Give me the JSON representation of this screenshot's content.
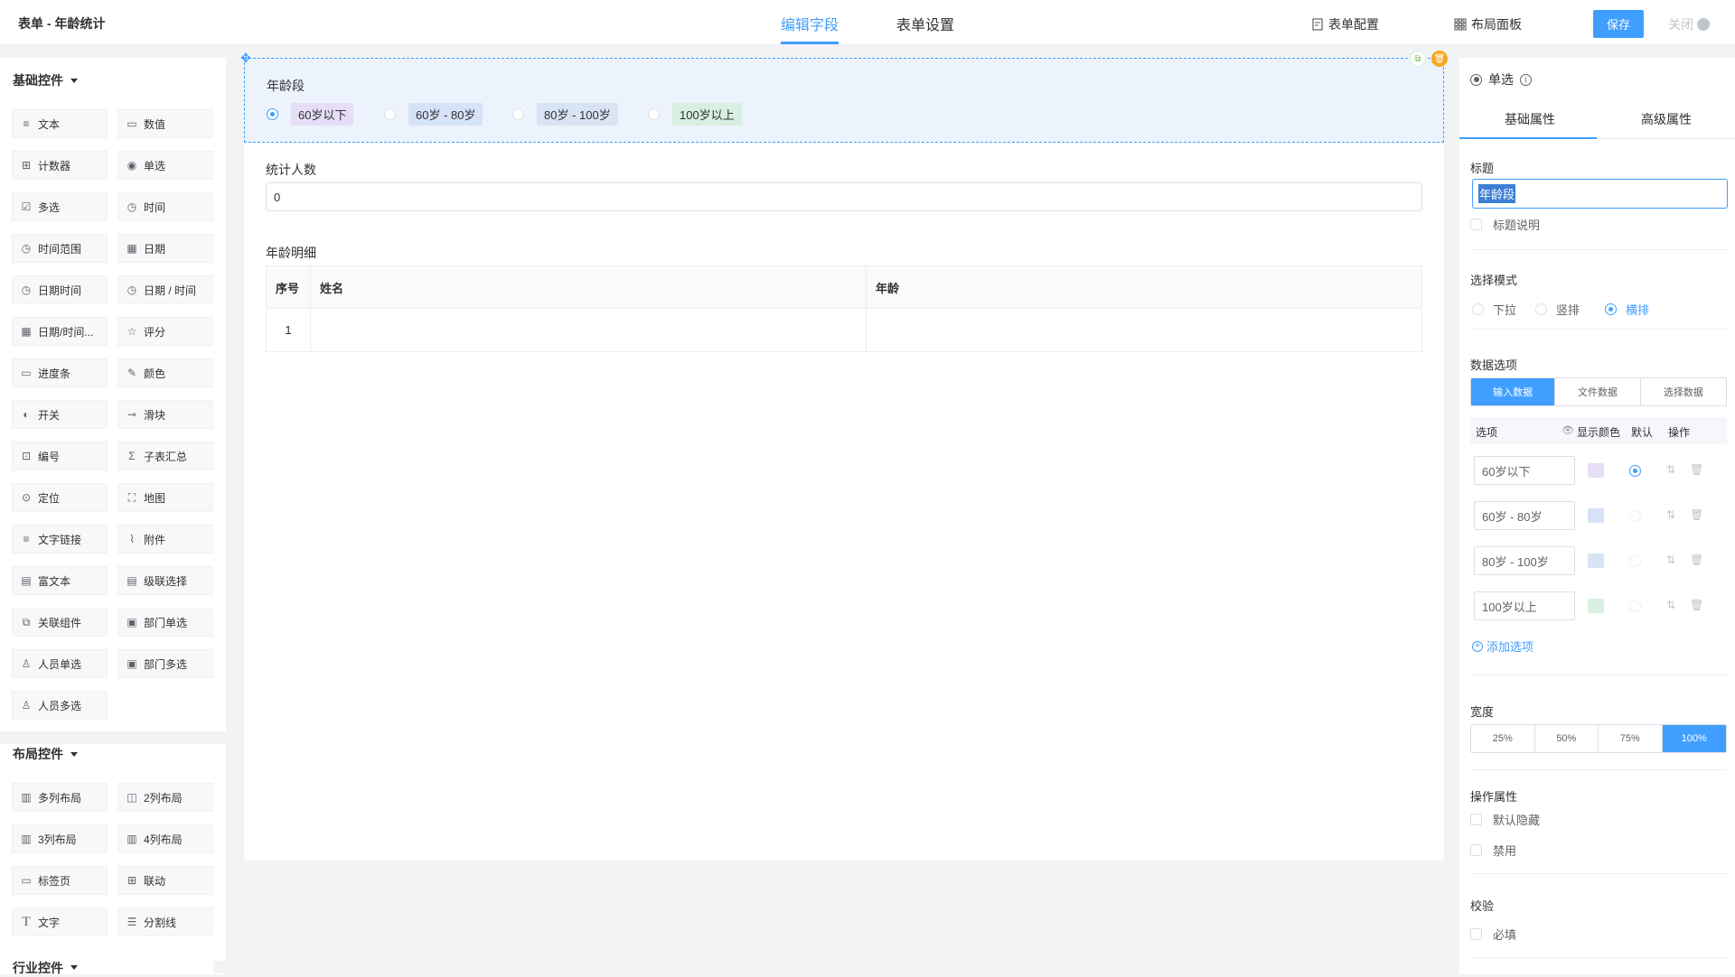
{
  "header": {
    "title": "表单 - 年龄统计",
    "tabs": [
      {
        "label": "编辑字段",
        "active": true
      },
      {
        "label": "表单设置",
        "active": false
      }
    ],
    "form_config": "表单配置",
    "layout_panel": "布局面板",
    "save": "保存",
    "close": "关闭"
  },
  "left": {
    "basic_group": "基础控件",
    "basic": [
      {
        "label": "文本",
        "icon": "text-icon"
      },
      {
        "label": "数值",
        "icon": "number-icon"
      },
      {
        "label": "计数器",
        "icon": "counter-icon"
      },
      {
        "label": "单选",
        "icon": "radio-icon"
      },
      {
        "label": "多选",
        "icon": "checkbox-icon"
      },
      {
        "label": "时间",
        "icon": "clock-icon"
      },
      {
        "label": "时间范围",
        "icon": "clock-icon"
      },
      {
        "label": "日期",
        "icon": "calendar-icon"
      },
      {
        "label": "日期时间",
        "icon": "clock-icon"
      },
      {
        "label": "日期 / 时间",
        "icon": "clock-icon"
      },
      {
        "label": "日期/时间...",
        "icon": "calendar-icon"
      },
      {
        "label": "评分",
        "icon": "star-icon"
      },
      {
        "label": "进度条",
        "icon": "progress-icon"
      },
      {
        "label": "颜色",
        "icon": "color-picker-icon"
      },
      {
        "label": "开关",
        "icon": "switch-icon"
      },
      {
        "label": "滑块",
        "icon": "slider-icon"
      },
      {
        "label": "编号",
        "icon": "serial-number-icon"
      },
      {
        "label": "子表汇总",
        "icon": "sigma-icon"
      },
      {
        "label": "定位",
        "icon": "location-icon"
      },
      {
        "label": "地图",
        "icon": "map-icon"
      },
      {
        "label": "文字链接",
        "icon": "text-link-icon"
      },
      {
        "label": "附件",
        "icon": "paperclip-icon"
      },
      {
        "label": "富文本",
        "icon": "rich-text-icon"
      },
      {
        "label": "级联选择",
        "icon": "cascader-icon"
      },
      {
        "label": "关联组件",
        "icon": "link-component-icon"
      },
      {
        "label": "部门单选",
        "icon": "department-icon"
      },
      {
        "label": "人员单选",
        "icon": "user-icon"
      },
      {
        "label": "部门多选",
        "icon": "department-multi-icon"
      },
      {
        "label": "人员多选",
        "icon": "users-icon"
      }
    ],
    "layout_group": "布局控件",
    "layout": [
      {
        "label": "多列布局",
        "icon": "columns-icon"
      },
      {
        "label": "2列布局",
        "icon": "two-columns-icon"
      },
      {
        "label": "3列布局",
        "icon": "three-columns-icon"
      },
      {
        "label": "4列布局",
        "icon": "four-columns-icon"
      },
      {
        "label": "标签页",
        "icon": "tabs-icon"
      },
      {
        "label": "联动",
        "icon": "grid-icon"
      },
      {
        "label": "文字",
        "icon": "type-icon"
      },
      {
        "label": "分割线",
        "icon": "divider-icon"
      }
    ],
    "industry_group": "行业控件"
  },
  "canvas": {
    "age_field": {
      "label": "年龄段",
      "options": [
        {
          "label": "60岁以下",
          "color": "#e5def6",
          "checked": true
        },
        {
          "label": "60岁 - 80岁",
          "color": "#d6e2f7",
          "checked": false
        },
        {
          "label": "80岁 - 100岁",
          "color": "#d8e4f3",
          "checked": false
        },
        {
          "label": "100岁以上",
          "color": "#d7f0df",
          "checked": false
        }
      ]
    },
    "count_field": {
      "label": "统计人数",
      "value": "0"
    },
    "detail_field": {
      "label": "年龄明细",
      "columns": [
        "序号",
        "姓名",
        "年龄"
      ],
      "rows": [
        [
          "1",
          "",
          ""
        ]
      ]
    }
  },
  "right": {
    "type_label": "单选",
    "tabs": [
      "基础属性",
      "高级属性"
    ],
    "title_section": "标题",
    "title_value": "年龄段",
    "title_desc": "标题说明",
    "mode_section": "选择模式",
    "modes": [
      {
        "label": "下拉",
        "checked": false
      },
      {
        "label": "竖排",
        "checked": false
      },
      {
        "label": "横排",
        "checked": true
      }
    ],
    "data_section": "数据选项",
    "data_tabs": [
      {
        "label": "输入数据",
        "active": true
      },
      {
        "label": "文件数据",
        "active": false
      },
      {
        "label": "选择数据",
        "active": false
      }
    ],
    "opt_headers": {
      "option": "选项",
      "show_color": "显示颜色",
      "default": "默认",
      "action": "操作"
    },
    "options": [
      {
        "value": "60岁以下",
        "color": "#e5def6",
        "default": true
      },
      {
        "value": "60岁 - 80岁",
        "color": "#d6e2f7",
        "default": false
      },
      {
        "value": "80岁 - 100岁",
        "color": "#d8e4f3",
        "default": false
      },
      {
        "value": "100岁以上",
        "color": "#d7f0df",
        "default": false
      }
    ],
    "add_option": "添加选项",
    "width_section": "宽度",
    "widths": [
      {
        "label": "25%",
        "active": false
      },
      {
        "label": "50%",
        "active": false
      },
      {
        "label": "75%",
        "active": false
      },
      {
        "label": "100%",
        "active": true
      }
    ],
    "action_section": "操作属性",
    "hide_default": "默认隐藏",
    "disabled": "禁用",
    "validate_section": "校验",
    "required": "必填"
  },
  "accent_color": "#409eff"
}
